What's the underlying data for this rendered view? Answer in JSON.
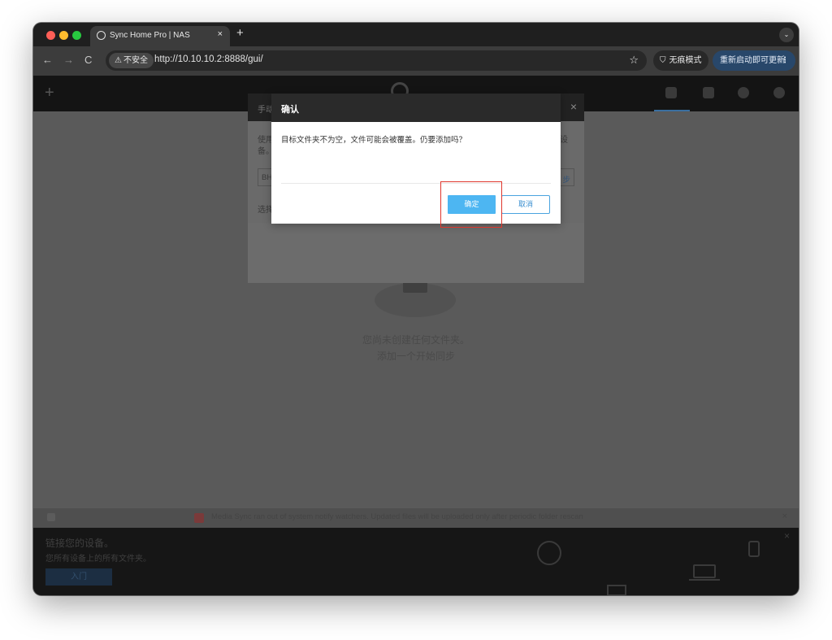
{
  "browser": {
    "tab_title": "Sync Home Pro | NAS",
    "tab_close": "×",
    "new_tab": "+",
    "tab_search_icon": "⌄",
    "nav_back": "←",
    "nav_forward": "→",
    "nav_reload": "C",
    "security_label": "不安全",
    "url": "http://10.10.10.2:8888/gui/",
    "bookmark_icon": "☆",
    "incognito_label": "无痕模式",
    "relaunch_label": "重新启动即可更新",
    "menu_icon": "⋮"
  },
  "app": {
    "empty_line_1": "您尚未创建任何文件夹。",
    "empty_line_2": "添加一个开始同步",
    "notice_text": "Media Sync ran out of system notify watchers. Updated files will be uploaded only after periodic folder rescan",
    "notice_close": "×",
    "bottom_title": "链接您的设备。",
    "bottom_sub": "您所有设备上的所有文件夹。",
    "bottom_button": "入门",
    "bottom_close": "×"
  },
  "background_modal": {
    "title": "手动",
    "close": "×",
    "line1": "使用",
    "line1b": "备。",
    "line1_right": "设",
    "input_value": "BH",
    "input_button": "步",
    "line2": "选择"
  },
  "dialog": {
    "title": "确认",
    "message": "目标文件夹不为空，文件可能会被覆盖。仍要添加吗？",
    "ok_label": "确定",
    "cancel_label": "取消"
  }
}
